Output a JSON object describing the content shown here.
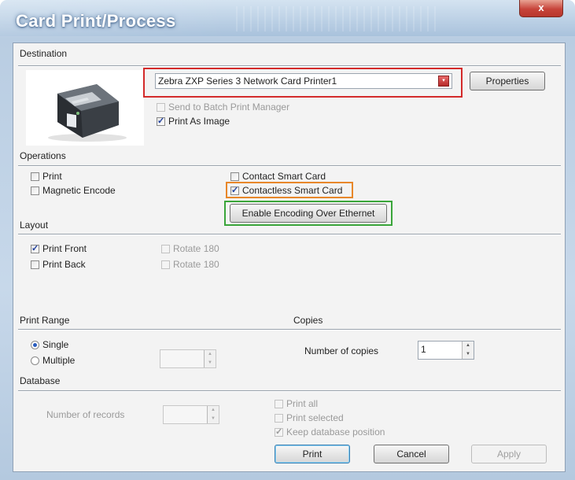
{
  "window": {
    "title": "Card Print/Process",
    "close_label": "x"
  },
  "destination": {
    "heading": "Destination",
    "printer_value": "Zebra ZXP Series 3 Network Card Printer1",
    "properties_label": "Properties",
    "send_batch_label": "Send to Batch Print Manager",
    "print_as_image_label": "Print As Image"
  },
  "operations": {
    "heading": "Operations",
    "print_label": "Print",
    "magnetic_label": "Magnetic Encode",
    "contact_label": "Contact Smart Card",
    "contactless_label": "Contactless Smart Card",
    "enable_encoding_label": "Enable Encoding Over Ethernet"
  },
  "layout": {
    "heading": "Layout",
    "print_front_label": "Print Front",
    "print_back_label": "Print Back",
    "rotate_front_label": "Rotate 180",
    "rotate_back_label": "Rotate 180"
  },
  "print_range": {
    "heading": "Print Range",
    "single_label": "Single",
    "multiple_label": "Multiple"
  },
  "copies": {
    "heading": "Copies",
    "number_label": "Number of copies",
    "value": "1"
  },
  "database": {
    "heading": "Database",
    "records_label": "Number of records",
    "print_all_label": "Print all",
    "print_selected_label": "Print selected",
    "keep_position_label": "Keep database position"
  },
  "buttons": {
    "print": "Print",
    "cancel": "Cancel",
    "apply": "Apply"
  },
  "colors": {
    "highlight_red": "#d32a2a",
    "highlight_orange": "#e8872a",
    "highlight_green": "#3aa53a"
  }
}
